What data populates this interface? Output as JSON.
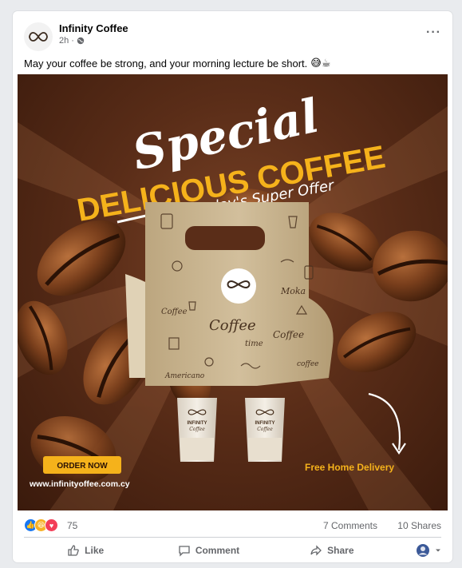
{
  "post": {
    "page_name": "Infinity Coffee",
    "timestamp": "2h",
    "caption": "May your coffee be strong, and your morning lecture be short.",
    "caption_emoji": "😅☕"
  },
  "ad": {
    "headline_script": "Special",
    "headline_bold": "DELICIOUS COFFEE",
    "subheadline": "Today's Super Offer",
    "cta_label": "ORDER NOW",
    "website": "www.infinityoffee.com.cy",
    "delivery": "Free Home Delivery",
    "cup_brand": "INFINITY",
    "cup_sub": "Coffee",
    "bag_words": [
      "Coffee",
      "time",
      "Moka",
      "Coffee",
      "Coffee",
      "Americano",
      "coffee"
    ]
  },
  "stats": {
    "reaction_count": "75",
    "comments": "7 Comments",
    "shares": "10 Shares"
  },
  "actions": {
    "like": "Like",
    "comment": "Comment",
    "share": "Share"
  },
  "colors": {
    "accent_yellow": "#f5b21b",
    "facebook_blue": "#1877f2",
    "text_secondary": "#65676b",
    "bag_kraft": "#c8b492"
  }
}
